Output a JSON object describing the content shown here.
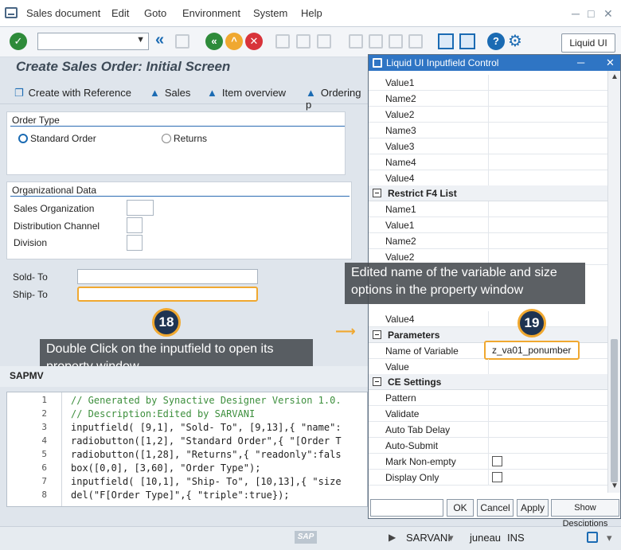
{
  "menu": [
    "Sales document",
    "Edit",
    "Goto",
    "Environment",
    "System",
    "Help"
  ],
  "toolbar": {
    "liquid_ui_label": "Liquid UI"
  },
  "screen_title": "Create Sales Order: Initial Screen",
  "app_toolbar": {
    "create_with_reference": "Create with Reference",
    "sales": "Sales",
    "item_overview": "Item overview",
    "ordering_party": "Ordering p"
  },
  "order_type": {
    "title": "Order Type",
    "standard_order": "Standard Order",
    "returns": "Returns"
  },
  "org_data": {
    "title": "Organizational Data",
    "sales_org": "Sales Organization",
    "distribution_channel": "Distribution Channel",
    "division": "Division"
  },
  "partner": {
    "sold_to": "Sold- To",
    "ship_to": "Ship- To"
  },
  "callouts": {
    "step18_num": "18",
    "step18_text": "Double Click on the inputfield to open its property window",
    "step19_num": "19",
    "step19_text": "Edited name of the variable and size options in the property window"
  },
  "editor": {
    "tab": "SAPMV",
    "lines": [
      {
        "no": "1",
        "text": "// Generated by Synactive Designer Version 1.0."
      },
      {
        "no": "2",
        "text": "// Description:Edited by SARVANI"
      },
      {
        "no": "3",
        "text": "inputfield( [9,1], \"Sold- To\", [9,13],{ \"name\":"
      },
      {
        "no": "4",
        "text": "radiobutton([1,2], \"Standard Order\",{ \"[Order T"
      },
      {
        "no": "5",
        "text": "radiobutton([1,28], \"Returns\",{ \"readonly\":fals"
      },
      {
        "no": "6",
        "text": "box([0,0], [3,60], \"Order Type\");"
      },
      {
        "no": "7",
        "text": "inputfield( [10,1], \"Ship- To\", [10,13],{ \"size"
      },
      {
        "no": "8",
        "text": "del(\"F[Order Type]\",{ \"triple\":true});"
      }
    ]
  },
  "property_window": {
    "title": "Liquid UI Inputfield Control",
    "rows_top": [
      "Value1",
      "Name2",
      "Value2",
      "Name3",
      "Value3",
      "Name4",
      "Value4"
    ],
    "restrict_f4": {
      "title": "Restrict F4 List",
      "rows": [
        "Name1",
        "Value1",
        "Name2",
        "Value2"
      ]
    },
    "value4_row": "Value4",
    "parameters": {
      "title": "Parameters",
      "name_of_variable_label": "Name of Variable",
      "name_of_variable_value": "z_va01_ponumber",
      "value_label": "Value"
    },
    "ce_settings": {
      "title": "CE Settings",
      "rows": [
        "Pattern",
        "Validate",
        "Auto Tab Delay",
        "Auto-Submit",
        "Mark Non-empty",
        "Display Only"
      ]
    },
    "buttons": {
      "ok": "OK",
      "cancel": "Cancel",
      "apply": "Apply",
      "show_descriptions": "Show Desciptions"
    }
  },
  "status_bar": {
    "user": "SARVANI",
    "server": "juneau",
    "mode": "INS"
  }
}
